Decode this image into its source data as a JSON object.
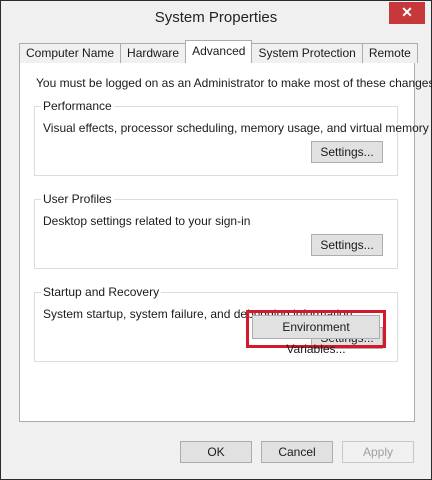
{
  "window": {
    "title": "System Properties",
    "close_label": "✕"
  },
  "tabs": [
    {
      "label": "Computer Name",
      "active": false
    },
    {
      "label": "Hardware",
      "active": false
    },
    {
      "label": "Advanced",
      "active": true
    },
    {
      "label": "System Protection",
      "active": false
    },
    {
      "label": "Remote",
      "active": false
    }
  ],
  "advanced": {
    "notice": "You must be logged on as an Administrator to make most of these changes.",
    "performance": {
      "legend": "Performance",
      "description": "Visual effects, processor scheduling, memory usage, and virtual memory",
      "button": "Settings..."
    },
    "user_profiles": {
      "legend": "User Profiles",
      "description": "Desktop settings related to your sign-in",
      "button": "Settings..."
    },
    "startup_recovery": {
      "legend": "Startup and Recovery",
      "description": "System startup, system failure, and debugging information",
      "button": "Settings..."
    },
    "environment_button": "Environment Variables...",
    "highlight_color": "#d4192a"
  },
  "footer": {
    "ok": "OK",
    "cancel": "Cancel",
    "apply": "Apply"
  }
}
